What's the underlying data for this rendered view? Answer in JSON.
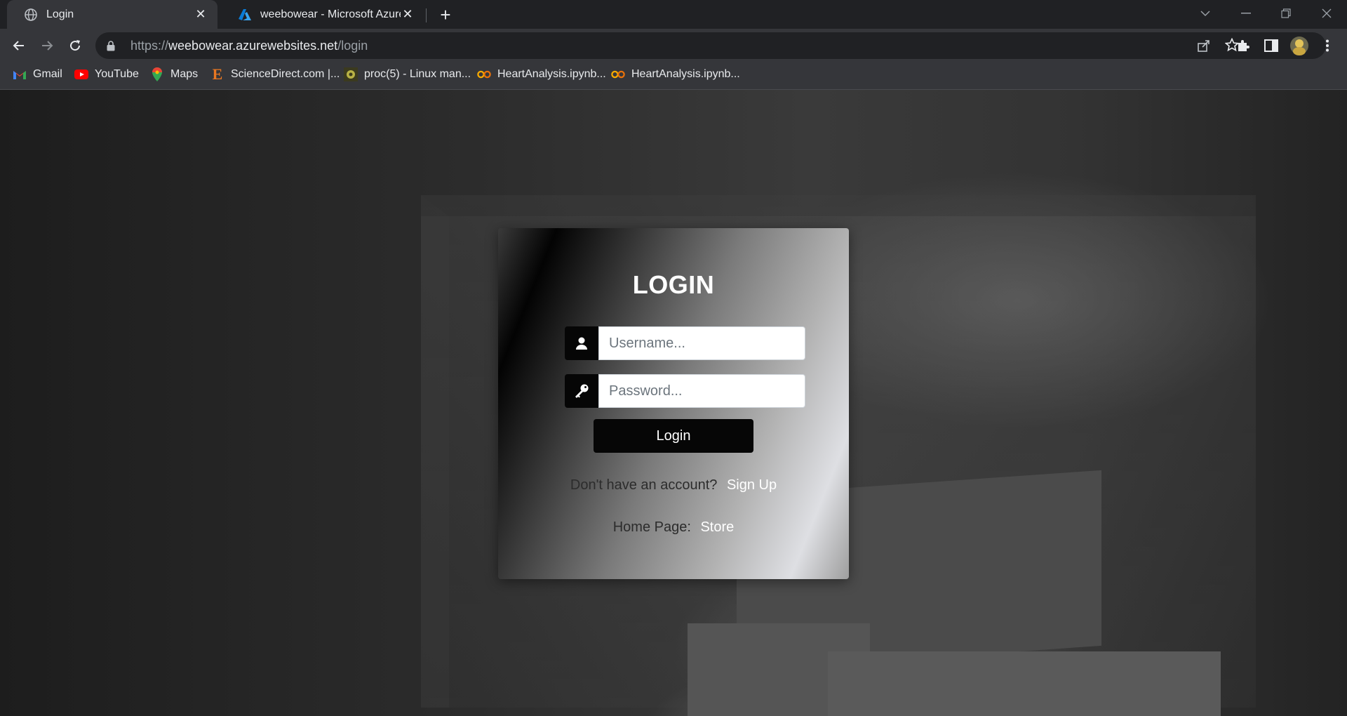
{
  "browser": {
    "tabs": [
      {
        "title": "Login",
        "favicon": "globe-icon",
        "active": true
      },
      {
        "title": "weebowear - Microsoft Azure",
        "favicon": "azure-icon",
        "active": false
      }
    ],
    "url": {
      "scheme": "https://",
      "host": "weebowear.azurewebsites.net",
      "path": "/login"
    },
    "bookmarks": [
      {
        "label": "Gmail",
        "icon": "gmail-icon"
      },
      {
        "label": "YouTube",
        "icon": "youtube-icon"
      },
      {
        "label": "Maps",
        "icon": "maps-icon"
      },
      {
        "label": "ScienceDirect.com |...",
        "icon": "sciencedirect-icon"
      },
      {
        "label": "proc(5) - Linux man...",
        "icon": "linux-man-icon"
      },
      {
        "label": "HeartAnalysis.ipynb...",
        "icon": "colab-icon"
      },
      {
        "label": "HeartAnalysis.ipynb...",
        "icon": "colab-icon"
      }
    ]
  },
  "login": {
    "title": "LOGIN",
    "username_placeholder": "Username...",
    "password_placeholder": "Password...",
    "button_label": "Login",
    "signup_prompt": "Don't have an account?",
    "signup_link": "Sign Up",
    "home_prompt": "Home Page:",
    "home_link": "Store"
  },
  "colors": {
    "chrome_dark": "#202124",
    "chrome_toolbar": "#35363a",
    "button_black": "#060606"
  }
}
